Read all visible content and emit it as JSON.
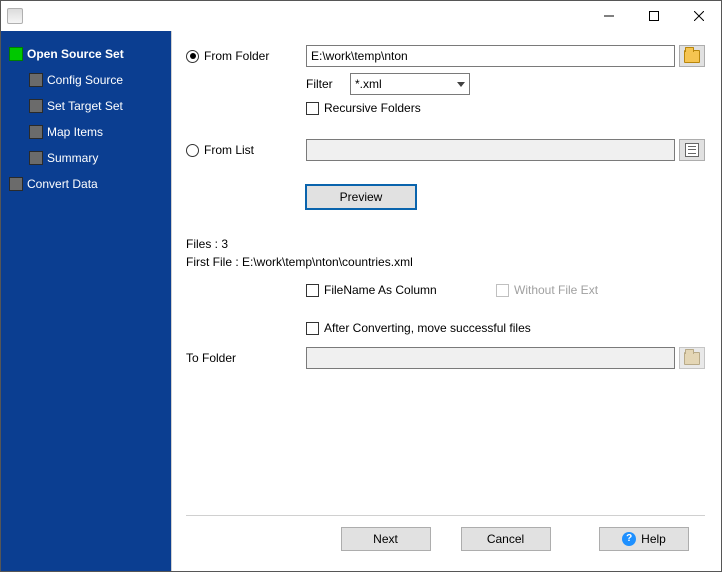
{
  "sidebar": {
    "items": [
      {
        "label": "Open Source Set",
        "active": true
      },
      {
        "label": "Config Source"
      },
      {
        "label": "Set Target Set"
      },
      {
        "label": "Map Items"
      },
      {
        "label": "Summary"
      },
      {
        "label": "Convert Data"
      }
    ]
  },
  "form": {
    "from_folder_label": "From Folder",
    "from_folder_value": "E:\\work\\temp\\nton",
    "filter_label": "Filter",
    "filter_value": "*.xml",
    "recursive_label": "Recursive Folders",
    "from_list_label": "From List",
    "from_list_value": "",
    "preview_label": "Preview",
    "files_count_label": "Files : 3",
    "first_file_label": "First File : E:\\work\\temp\\nton\\countries.xml",
    "filename_as_column_label": "FileName As Column",
    "without_ext_label": "Without File Ext",
    "after_convert_label": "After Converting, move successful files",
    "to_folder_label": "To Folder",
    "to_folder_value": ""
  },
  "footer": {
    "next": "Next",
    "cancel": "Cancel",
    "help": "Help"
  }
}
